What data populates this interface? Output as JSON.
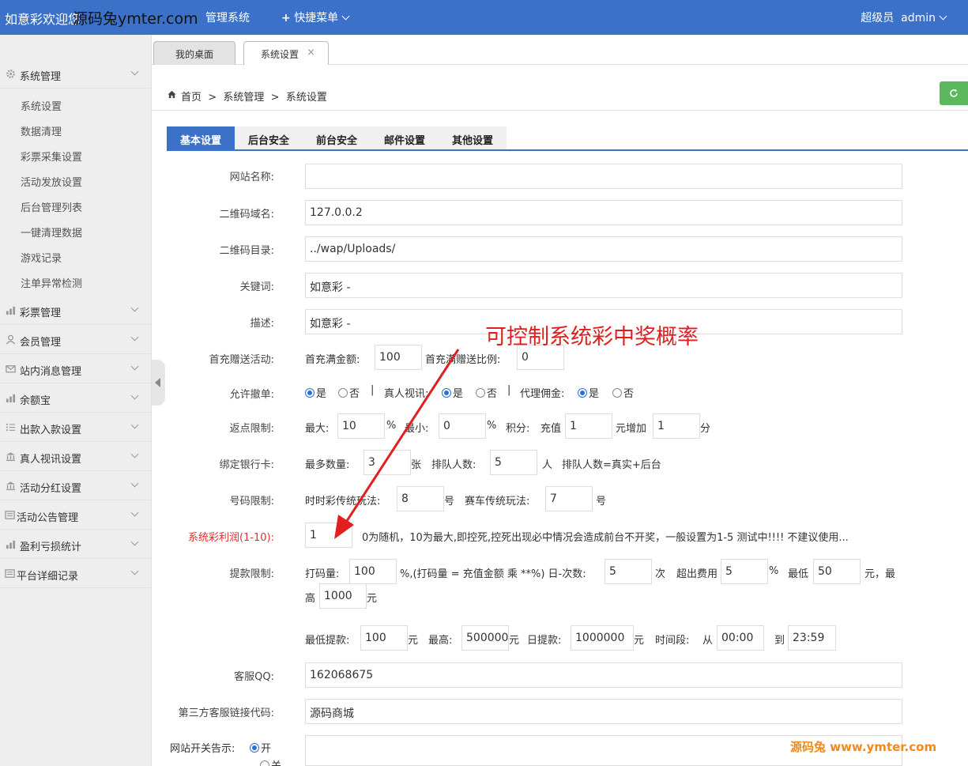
{
  "topbar": {
    "brand": "如意彩欢迎您",
    "watermark": "源码兔ymter.com",
    "system": "管理系统",
    "quick_menu": "快捷菜单",
    "quick_plus": "+",
    "user_role": "超级员",
    "user_name": "admin"
  },
  "sidebar": {
    "system": "系统管理",
    "system_items": [
      "系统设置",
      "数据清理",
      "彩票采集设置",
      "活动发放设置",
      "后台管理列表",
      "一键清理数据",
      "游戏记录",
      "注单异常检测"
    ],
    "groups": [
      "彩票管理",
      "会员管理",
      "站内消息管理",
      "余额宝",
      "出款入款设置",
      "真人视讯设置",
      "活动分红设置",
      "活动公告管理",
      "盈利亏损统计",
      "平台详细记录"
    ]
  },
  "page_tabs": {
    "desk": "我的桌面",
    "settings": "系统设置",
    "close": "×"
  },
  "breadcrumb": {
    "path": "首页  >  系统管理  >  系统设置"
  },
  "form_tabs": [
    "基本设置",
    "后台安全",
    "前台安全",
    "邮件设置",
    "其他设置"
  ],
  "form": {
    "site_name_label": "网站名称:",
    "site_name_value": "",
    "qr_domain_label": "二维码域名:",
    "qr_domain_value": "127.0.0.2",
    "qr_dir_label": "二维码目录:",
    "qr_dir_value": "../wap/Uploads/",
    "keywords_label": "关键词:",
    "keywords_value": "如意彩 -",
    "desc_label": "描述:",
    "desc_value": "如意彩 -",
    "first_charge_label": "首充赠送活动:",
    "first_charge_full": "首充满金额:",
    "first_charge_full_value": "100",
    "first_charge_ratio": "首充满赠送比例:",
    "first_charge_ratio_value": "0",
    "withdraw_cancel_label": "允许撤单:",
    "yes": "是",
    "no": "否",
    "sep": "|",
    "live_video": "真人视讯:",
    "agent_comm": "代理佣金:",
    "rebate_label": "返点限制:",
    "rebate_max": "最大:",
    "rebate_max_value": "10",
    "pct": "%",
    "rebate_min": "最小:",
    "rebate_min_value": "0",
    "points": "积分:",
    "recharge": "充值",
    "recharge_value": "1",
    "yuan_add": "元增加",
    "add_value": "1",
    "fen": "分",
    "bank_label": "绑定银行卡:",
    "bank_max": "最多数量:",
    "bank_max_value": "3",
    "zhang": "张",
    "queue": "排队人数:",
    "queue_value": "5",
    "ren": "人",
    "queue_note": "排队人数=真实+后台",
    "number_label": "号码限制:",
    "ssc": "时时彩传统玩法:",
    "ssc_value": "8",
    "hao": "号",
    "race": "赛车传统玩法:",
    "race_value": "7",
    "profit_label": "系统彩利润(1-10):",
    "profit_value": "1",
    "profit_note": "0为随机，10为最大,即控死,控死出现必中情况会造成前台不开奖，一般设置为1-5 测试中!!!! 不建议使用...",
    "withdraw_label": "提款限制:",
    "bet_amount": "打码量:",
    "bet_amount_value": "100",
    "bet_note": "%,(打码量 = 充值金额 乘 **%) 日-次数:",
    "times_value": "5",
    "ci": "次",
    "over_fee": "超出费用",
    "over_fee_value": "5",
    "lowest": "最低",
    "lowest_value": "50",
    "yuan_comma": "元，最",
    "gao": "高",
    "highest_value": "1000",
    "yuan": "元",
    "min_withdraw": "最低提款:",
    "min_withdraw_value": "100",
    "max": "最高:",
    "max_value": "500000",
    "daily": "日提款:",
    "daily_value": "1000000",
    "period": "时间段:",
    "from": "从",
    "from_value": "00:00",
    "to": "到",
    "to_value": "23:59",
    "qq_label": "客服QQ:",
    "qq_value": "162068675",
    "third_label": "第三方客服链接代码:",
    "third_value": "源码商城",
    "switch_label": "网站开关告示:",
    "switch_on": "开",
    "switch_off": "关"
  },
  "annotation": "可控制系统彩中奖概率",
  "footer_watermark": "源码兔 www.ymter.com",
  "colors": {
    "header": "#3b72c8",
    "refresh": "#5cb85c",
    "annotation": "#e02020",
    "watermark": "#f08a1a"
  }
}
